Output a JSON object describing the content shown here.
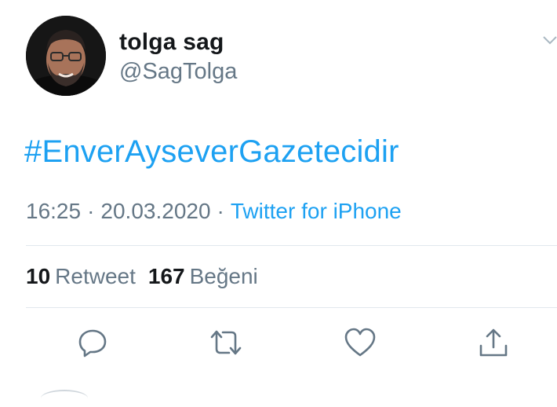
{
  "tweet": {
    "author_name": "tolga sag",
    "author_handle": "@SagTolga",
    "text": "#EnverAyseverGazetecidir",
    "time": "16:25",
    "date": "20.03.2020",
    "separator": "·",
    "source": "Twitter for iPhone",
    "retweet_count": "10",
    "retweet_label": "Retweet",
    "like_count": "167",
    "like_label": "Beğeni"
  },
  "actions": {
    "reply_icon": "reply-icon",
    "retweet_icon": "retweet-icon",
    "like_icon": "heart-icon",
    "share_icon": "share-icon"
  },
  "colors": {
    "accent": "#1da1f2",
    "secondary_text": "#657786",
    "primary_text": "#14171a",
    "divider": "#e1e8ed",
    "icon": "#657786"
  }
}
